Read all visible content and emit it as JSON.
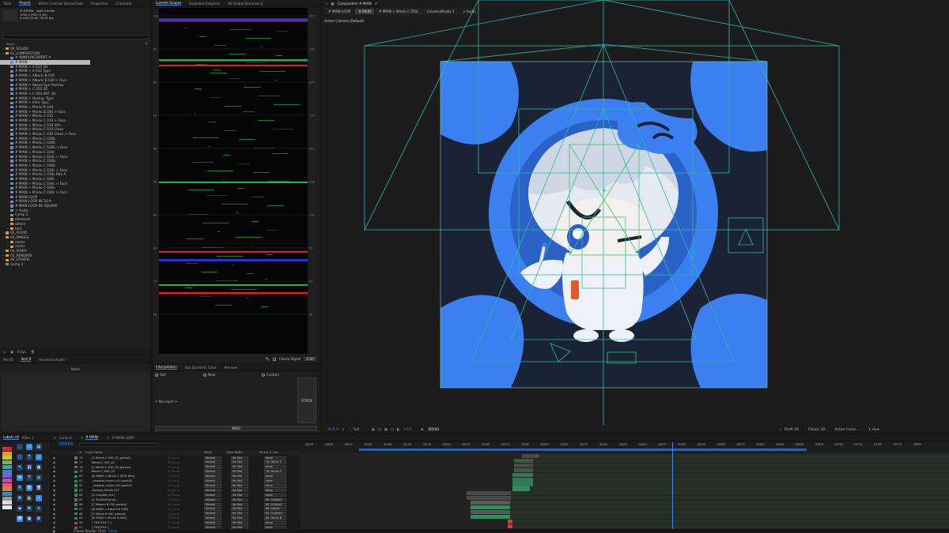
{
  "project_panel": {
    "tabs": [
      "Tools",
      "Project",
      "Effect Controls StereoCode",
      "Properties",
      "Character"
    ],
    "selected_item": {
      "name": "# SHOW▾ , used 3 times",
      "line1": "1920 x 1920 (1.00)",
      "line2": "Δ 0:00:12:00, 30.00 fps"
    },
    "search_placeholder": "",
    "header_name": "Name",
    "items": [
      {
        "label": "00_SOLIDS",
        "type": "folder",
        "depth": 0
      },
      {
        "label": "01_COMPOSITION",
        "type": "folder",
        "depth": 0
      },
      {
        "label": "# ANNOUNCEMENT A",
        "type": "comp",
        "depth": 1
      },
      {
        "label": "# MAIN",
        "type": "comp",
        "depth": 1,
        "selected": true
      },
      {
        "label": "# MAIN > A 010 3D",
        "type": "comp",
        "depth": 1
      },
      {
        "label": "# MAIN > A 010 Typo",
        "type": "comp",
        "depth": 1
      },
      {
        "label": "# MAIN > Albumi B 030",
        "type": "comp",
        "depth": 1
      },
      {
        "label": "# MAIN > Albumi B 030 > Face",
        "type": "comp",
        "depth": 1
      },
      {
        "label": "# MAIN > Above Eye Overlay",
        "type": "comp",
        "depth": 1
      },
      {
        "label": "# MAIN > C 050 3D",
        "type": "comp",
        "depth": 1
      },
      {
        "label": "# MAIN > C 050 ANT 3D",
        "type": "comp",
        "depth": 1
      },
      {
        "label": "# MAIN > Honkan Typo",
        "type": "comp",
        "depth": 1
      },
      {
        "label": "# MAIN > Intro Typo",
        "type": "comp",
        "depth": 1
      },
      {
        "label": "# MAIN > Mindu B 040",
        "type": "comp",
        "depth": 1
      },
      {
        "label": "# MAIN > Mindu B 040 > Face",
        "type": "comp",
        "depth": 1
      },
      {
        "label": "# MAIN > Mindu C 010",
        "type": "comp",
        "depth": 1
      },
      {
        "label": "# MAIN > Mindu C 010 > Face",
        "type": "comp",
        "depth": 1
      },
      {
        "label": "# MAIN > Mindu C 010 Afm",
        "type": "comp",
        "depth": 1
      },
      {
        "label": "# MAIN > Mindu C 010 Clean",
        "type": "comp",
        "depth": 1
      },
      {
        "label": "# MAIN > Mindu C 010 Clean > Face",
        "type": "comp",
        "depth": 1
      },
      {
        "label": "# MAIN > Mindu C 020b",
        "type": "comp",
        "depth": 1
      },
      {
        "label": "# MAIN > Mindu C 020b",
        "type": "comp",
        "depth": 1
      },
      {
        "label": "# MAIN > Mindu C 020b > Face",
        "type": "comp",
        "depth": 1
      },
      {
        "label": "# MAIN > Mindu C 020c",
        "type": "comp",
        "depth": 1
      },
      {
        "label": "# MAIN > Mindu C 020c > Face",
        "type": "comp",
        "depth": 1
      },
      {
        "label": "# MAIN > Mindu C 030b",
        "type": "comp",
        "depth": 1
      },
      {
        "label": "# MAIN > Mindu C 030b",
        "type": "comp",
        "depth": 1
      },
      {
        "label": "# MAIN > Mindu C 030c > Face",
        "type": "comp",
        "depth": 1
      },
      {
        "label": "# MAIN > Mindu C 030c Afm A",
        "type": "comp",
        "depth": 1
      },
      {
        "label": "# MAIN > Mindu C 030c",
        "type": "comp",
        "depth": 1
      },
      {
        "label": "# MAIN > Mindu C 030c > Face",
        "type": "comp",
        "depth": 1
      },
      {
        "label": "# MAIN > Mindu C 030c",
        "type": "comp",
        "depth": 1
      },
      {
        "label": "# MAIN > Mindu C 030c > Face",
        "type": "comp",
        "depth": 1
      },
      {
        "label": "# MAIN LOOP",
        "type": "comp",
        "depth": 1
      },
      {
        "label": "# MAIN LOOP 8K 16:9",
        "type": "comp",
        "depth": 1
      },
      {
        "label": "# MAIN LOOP 8K SQUARE",
        "type": "comp",
        "depth": 1
      },
      {
        "label": "> Audio",
        "type": "comp",
        "depth": 1
      },
      {
        "label": "Comp 3",
        "type": "comp",
        "depth": 1
      },
      {
        "label": "elements",
        "type": "folder",
        "depth": 1
      },
      {
        "label": "others",
        "type": "folder",
        "depth": 1
      },
      {
        "label": "text",
        "type": "folder",
        "depth": 1
      },
      {
        "label": "02_AUDIO",
        "type": "folder",
        "depth": 0
      },
      {
        "label": "03_IMAGES",
        "type": "folder",
        "depth": 0
      },
      {
        "label": "raster",
        "type": "folder",
        "depth": 1
      },
      {
        "label": "vector",
        "type": "folder",
        "depth": 1
      },
      {
        "label": "04_VIDEO",
        "type": "folder",
        "depth": 0
      },
      {
        "label": "05_RENDERS",
        "type": "folder",
        "depth": 0
      },
      {
        "label": "06_OTHERS",
        "type": "folder",
        "depth": 0
      },
      {
        "label": "Comp 4",
        "type": "comp",
        "depth": 0
      }
    ],
    "footer_bpc": "8 bpc"
  },
  "proid_panel": {
    "tabs": [
      "Pro ID",
      "Sort It",
      "Universal Audio"
    ],
    "value": "None"
  },
  "scopes_panel": {
    "tabs": [
      "Lumetri Scopes",
      "Essential Graphics",
      "AE Global Renamer 2"
    ],
    "left_ticks": [
      "100",
      "90",
      "80",
      "70",
      "60",
      "50",
      "40",
      "30",
      "20",
      "10"
    ],
    "right_ticks": [
      "255",
      "230",
      "204",
      "178",
      "153",
      "128",
      "102",
      "76",
      "51",
      "26"
    ],
    "clamp_label": "Clamp Signal",
    "bit_label": "8 Bit"
  },
  "interp_panel": {
    "tabs": [
      "Interpolation",
      "Ray Dynamic Color",
      "Preview"
    ],
    "options": [
      "Self",
      "New",
      "Custom"
    ],
    "no_layer": "< No Layer >",
    "stock_label": "STOCK",
    "bind_label": "BIND"
  },
  "comp_panel": {
    "title": "Composition # MAIN",
    "tabs": [
      "# MAIN LOOP",
      "# MAIN",
      "# MAIN > Mindu C 050c",
      "UniversalAudio 1",
      "> Audio"
    ],
    "camera_label": "Active Camera (Default)",
    "zoom": "46.8 %",
    "resolution": "Full",
    "timecode": "00500",
    "renderer": "Draft 3D",
    "renderer2": "Classic 3D",
    "camera_dd": "Active Came...",
    "view_dd": "1 View",
    "exposure": "+0.0",
    "colors": {
      "bg": "#1a2336",
      "blue": "#3b7ff0",
      "guide": "#2fb8a8",
      "green": "#3ac46a"
    }
  },
  "labels_panel": {
    "tabs": [
      "Labels v4",
      "Killer 1"
    ],
    "swatches": [
      "#c33131",
      "#d9a032",
      "#c7c42f",
      "#6fb844",
      "#3aa9a0",
      "#3f7fd6",
      "#7a5ed0",
      "#c04fa8",
      "#d9607a",
      "#e37b2f",
      "#2c8ac9",
      "#999999",
      "#dddddd",
      "#e9e9e9"
    ]
  },
  "timeline": {
    "tabs": [
      "Comp 4",
      "# MAIN",
      "# MAIN LOOP"
    ],
    "timecode": "00500",
    "search_placeholder": "",
    "headers": {
      "num": "#",
      "layer": "Layer Name",
      "mode": "Mode",
      "trkmat": "Track Matte",
      "parent": "Parent & Link"
    },
    "ruler": [
      "00025",
      "00050",
      "00075",
      "00100",
      "00125",
      "00150",
      "00175",
      "00200",
      "00225",
      "00250",
      "00275",
      "00300",
      "00325",
      "00350",
      "00375",
      "00400",
      "00425",
      "00450",
      "00475",
      "00500",
      "00525",
      "00550",
      "00575",
      "00600",
      "00625",
      "00650",
      "00675",
      "00700",
      "00725",
      "00750",
      "00775",
      "00800"
    ],
    "layers": [
      {
        "num": "76",
        "name": "[C Mindu C 050_02_parent]",
        "mode": "Normal",
        "trk": "No Mat",
        "parent": "None",
        "color": "#6b6b6b"
      },
      {
        "num": "77",
        "name": "Mindu C 050_02",
        "mode": "Normal",
        "trk": "No Mat",
        "parent": "76. Mindu C",
        "color": "#6b6b6b"
      },
      {
        "num": "78",
        "name": "[C Mindu C 050_03_parent]",
        "mode": "Normal",
        "trk": "No Mat",
        "parent": "None",
        "color": "#6b6b6b"
      },
      {
        "num": "79",
        "name": "Mindu C 050_03",
        "mode": "Normal",
        "trk": "No Mat",
        "parent": "78. Mindu C",
        "color": "#6b6b6b"
      },
      {
        "num": "80",
        "name": "[# MAIN > Mindu C 050c Afm]",
        "mode": "Normal",
        "trk": "No Mat",
        "parent": "None",
        "color": "#2f8f5a"
      },
      {
        "num": "81",
        "name": "_shadow_mindu c01 point02",
        "mode": "Normal",
        "trk": "No Mat",
        "parent": "None",
        "color": "#2f8f5a"
      },
      {
        "num": "82",
        "name": "_shadow_mindu c01 point01",
        "mode": "Normal",
        "trk": "No Mat",
        "parent": "None",
        "color": "#2f8f5a"
      },
      {
        "num": "83",
        "name": "shadow_mindu c01",
        "mode": "Normal",
        "trk": "No Mat",
        "parent": "None",
        "color": "#2f8f5a"
      },
      {
        "num": "84",
        "name": "[C Graytab_ctrl]",
        "mode": "Normal",
        "trk": "No Mat",
        "parent": "None",
        "color": "#6b6b6b"
      },
      {
        "num": "85",
        "name": "[C ScDataFrame]",
        "mode": "Normal",
        "trk": "No Mat",
        "parent": "85. ScDataF",
        "color": "#6b6b6b"
      },
      {
        "num": "86",
        "name": "[C Albumi B 030_parent]",
        "mode": "Normal",
        "trk": "No Mat",
        "parent": "85. ScDataF",
        "color": "#6b6b6b"
      },
      {
        "num": "87",
        "name": "[# MAIN > Albumi B 030]",
        "mode": "Normal",
        "trk": "No Mat",
        "parent": "86. Albumi",
        "color": "#2f8f5a"
      },
      {
        "num": "88",
        "name": "[C Mindu B 040_parent]",
        "mode": "Normal",
        "trk": "No Mat",
        "parent": "85. ScDataF",
        "color": "#6b6b6b"
      },
      {
        "num": "89",
        "name": "[# MAIN > Mindu B 040]",
        "mode": "Normal",
        "trk": "No Mat",
        "parent": "88. Mindu B",
        "color": "#2f8f5a"
      },
      {
        "num": "90",
        "name": "[ TEXTFILE 2 ]",
        "mode": "Normal",
        "trk": "No Mat",
        "parent": "None",
        "color": "#c04040"
      },
      {
        "num": "91",
        "name": "[ TEXTFILE ]",
        "mode": "Normal",
        "trk": "No Mat",
        "parent": "None",
        "color": "#c04040"
      }
    ],
    "footer": "Frame Render Time",
    "footer_value": "10ms"
  }
}
